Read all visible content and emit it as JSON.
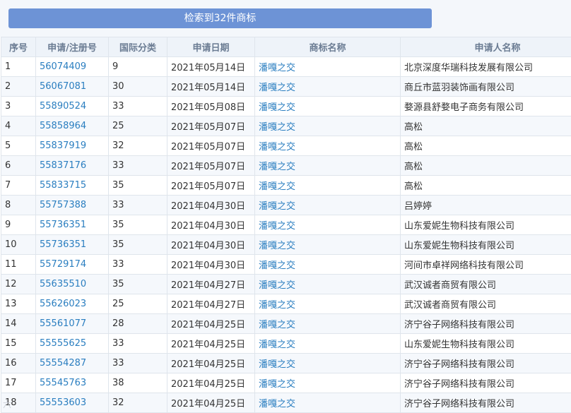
{
  "banner": {
    "result_label": "检索到32件商标"
  },
  "table": {
    "headers": [
      "序号",
      "申请/注册号",
      "国际分类",
      "申请日期",
      "商标名称",
      "申请人名称"
    ],
    "rows": [
      {
        "no": "1",
        "reg": "56074409",
        "cls": "9",
        "date": "2021年05月14日",
        "mark": "潘嘎之交",
        "applicant": "北京深度华瑞科技发展有限公司"
      },
      {
        "no": "2",
        "reg": "56067081",
        "cls": "30",
        "date": "2021年05月14日",
        "mark": "潘嘎之交",
        "applicant": "商丘市蓝羽装饰画有限公司"
      },
      {
        "no": "3",
        "reg": "55890524",
        "cls": "33",
        "date": "2021年05月08日",
        "mark": "潘嘎之交",
        "applicant": "婺源县舒婺电子商务有限公司"
      },
      {
        "no": "4",
        "reg": "55858964",
        "cls": "25",
        "date": "2021年05月07日",
        "mark": "潘嘎之交",
        "applicant": "高松"
      },
      {
        "no": "5",
        "reg": "55837919",
        "cls": "32",
        "date": "2021年05月07日",
        "mark": "潘嘎之交",
        "applicant": "高松"
      },
      {
        "no": "6",
        "reg": "55837176",
        "cls": "33",
        "date": "2021年05月07日",
        "mark": "潘嘎之交",
        "applicant": "高松"
      },
      {
        "no": "7",
        "reg": "55833715",
        "cls": "35",
        "date": "2021年05月07日",
        "mark": "潘嘎之交",
        "applicant": "高松"
      },
      {
        "no": "8",
        "reg": "55757388",
        "cls": "33",
        "date": "2021年04月30日",
        "mark": "潘嘎之交",
        "applicant": "吕婷婷"
      },
      {
        "no": "9",
        "reg": "55736351",
        "cls": "35",
        "date": "2021年04月30日",
        "mark": "潘嘎之交",
        "applicant": "山东爱妮生物科技有限公司"
      },
      {
        "no": "10",
        "reg": "55736351",
        "cls": "35",
        "date": "2021年04月30日",
        "mark": "潘嘎之交",
        "applicant": "山东爱妮生物科技有限公司"
      },
      {
        "no": "11",
        "reg": "55729174",
        "cls": "33",
        "date": "2021年04月30日",
        "mark": "潘嘎之交",
        "applicant": "河间市卓祥网络科技有限公司"
      },
      {
        "no": "12",
        "reg": "55635510",
        "cls": "35",
        "date": "2021年04月27日",
        "mark": "潘嘎之交",
        "applicant": "武汉诚者商贸有限公司"
      },
      {
        "no": "13",
        "reg": "55626023",
        "cls": "25",
        "date": "2021年04月27日",
        "mark": "潘嘎之交",
        "applicant": "武汉诚者商贸有限公司"
      },
      {
        "no": "14",
        "reg": "55561077",
        "cls": "28",
        "date": "2021年04月25日",
        "mark": "潘嘎之交",
        "applicant": "济宁谷子网络科技有限公司"
      },
      {
        "no": "15",
        "reg": "55555625",
        "cls": "33",
        "date": "2021年04月25日",
        "mark": "潘嘎之交",
        "applicant": "山东爱妮生物科技有限公司"
      },
      {
        "no": "16",
        "reg": "55554287",
        "cls": "33",
        "date": "2021年04月25日",
        "mark": "潘嘎之交",
        "applicant": "济宁谷子网络科技有限公司"
      },
      {
        "no": "17",
        "reg": "55545763",
        "cls": "38",
        "date": "2021年04月25日",
        "mark": "潘嘎之交",
        "applicant": "济宁谷子网络科技有限公司"
      },
      {
        "no": "18",
        "reg": "55553603",
        "cls": "32",
        "date": "2021年04月25日",
        "mark": "潘嘎之交",
        "applicant": "济宁谷子网络科技有限公司"
      }
    ]
  },
  "watermark": "六"
}
